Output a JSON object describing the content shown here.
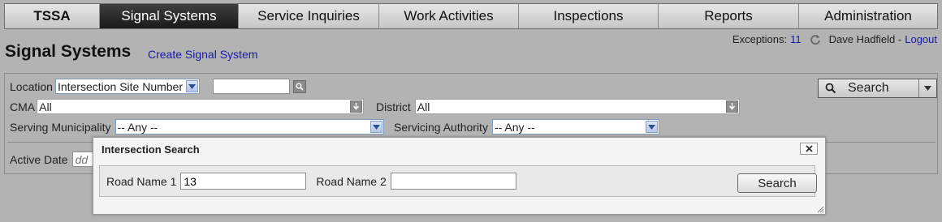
{
  "nav": {
    "items": [
      {
        "label": "TSSA"
      },
      {
        "label": "Signal Systems"
      },
      {
        "label": "Service Inquiries"
      },
      {
        "label": "Work Activities"
      },
      {
        "label": "Inspections"
      },
      {
        "label": "Reports"
      },
      {
        "label": "Administration"
      }
    ],
    "active_index": 1
  },
  "header": {
    "title": "Signal Systems",
    "create_link": "Create Signal System",
    "exceptions_label": "Exceptions:",
    "exceptions_count": "11",
    "user_name": "Dave Hadfield -",
    "logout_label": "Logout"
  },
  "filters": {
    "location_label": "Location",
    "location_value": "Intersection Site Number",
    "location_text": "",
    "cma_label": "CMA",
    "cma_value": "All",
    "district_label": "District",
    "district_value": "All",
    "serving_municipality_label": "Serving Municipality",
    "serving_municipality_value": "-- Any --",
    "servicing_authority_label": "Servicing Authority",
    "servicing_authority_value": "-- Any --",
    "active_date_label": "Active Date",
    "active_date_placeholder": "dd",
    "search_label": "Search"
  },
  "modal": {
    "title": "Intersection Search",
    "close_icon": "close-icon",
    "road1_label": "Road Name 1",
    "road1_value": "13",
    "road2_label": "Road Name 2",
    "road2_value": "",
    "search_label": "Search"
  },
  "colors": {
    "active_tab": "#1f1f1f",
    "link": "#1a1aa8",
    "background": "#b3b3b3"
  }
}
